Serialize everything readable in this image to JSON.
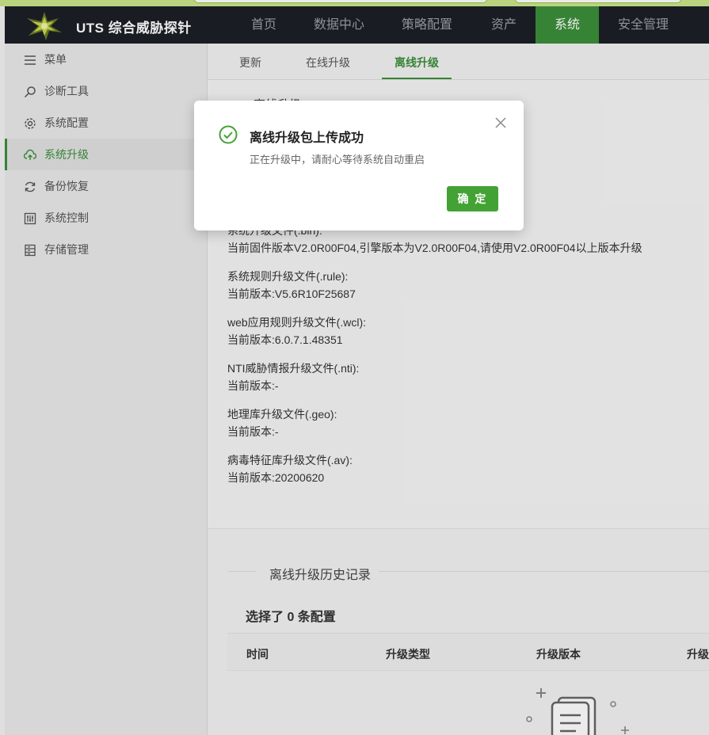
{
  "header": {
    "brand": "UTS 综合威胁探针",
    "nav": [
      "首页",
      "数据中心",
      "策略配置",
      "资产",
      "系统",
      "安全管理"
    ],
    "active_nav": "系统"
  },
  "sidebar": {
    "items": [
      {
        "label": "菜单",
        "icon": "menu-icon"
      },
      {
        "label": "诊断工具",
        "icon": "search-icon"
      },
      {
        "label": "系统配置",
        "icon": "gear-icon"
      },
      {
        "label": "系统升级",
        "icon": "cloud-upload-icon",
        "active": true
      },
      {
        "label": "备份恢复",
        "icon": "refresh-icon"
      },
      {
        "label": "系统控制",
        "icon": "sliders-icon"
      },
      {
        "label": "存储管理",
        "icon": "storage-icon"
      }
    ]
  },
  "tabs": [
    "更新",
    "在线升级",
    "离线升级"
  ],
  "active_tab": "离线升级",
  "offline": {
    "section_title_partial": "离线升级",
    "items": [
      {
        "label": "系统升级文件(.bin):",
        "value": "当前固件版本V2.0R00F04,引擎版本为V2.0R00F04,请使用V2.0R00F04以上版本升级"
      },
      {
        "label": "系统规则升级文件(.rule):",
        "value": "当前版本:V5.6R10F25687"
      },
      {
        "label": "web应用规则升级文件(.wcl):",
        "value": "当前版本:6.0.7.1.48351"
      },
      {
        "label": "NTI威胁情报升级文件(.nti):",
        "value": "当前版本:-"
      },
      {
        "label": "地理库升级文件(.geo):",
        "value": "当前版本:-"
      },
      {
        "label": "病毒特征库升级文件(.av):",
        "value": "当前版本:20200620"
      }
    ]
  },
  "history": {
    "title": "离线升级历史记录",
    "selected_text": "选择了 0 条配置",
    "columns": [
      "时间",
      "升级类型",
      "升级版本",
      "升级"
    ]
  },
  "modal": {
    "title": "离线升级包上传成功",
    "body": "正在升级中，请耐心等待系统自动重启",
    "ok_label": "确 定"
  },
  "colors": {
    "accent": "#3c8f3a",
    "button": "#43a234",
    "header_bg": "#1c2026"
  }
}
